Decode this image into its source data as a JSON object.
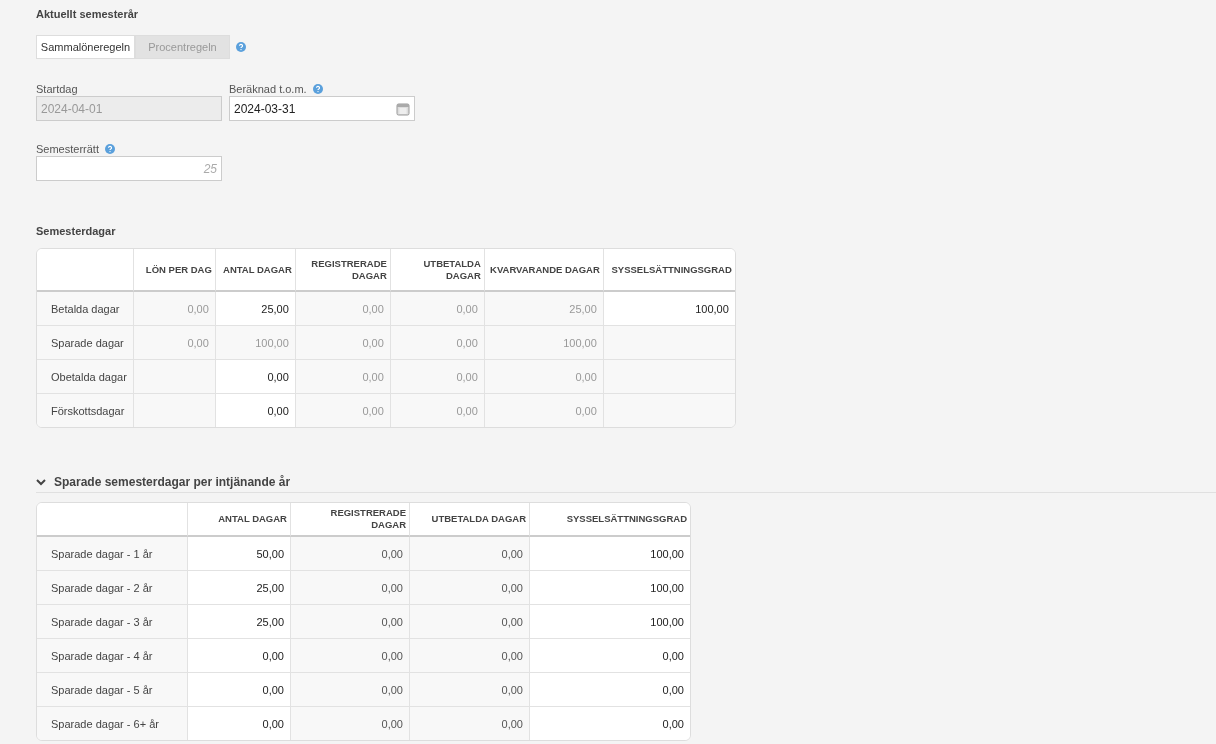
{
  "section_title": "Aktuellt semesterår",
  "rule_toggle": [
    {
      "label": "Sammalöneregeln",
      "selected": true
    },
    {
      "label": "Procentregeln",
      "selected": false
    }
  ],
  "fields": [
    {
      "label": "Startdag",
      "value": "2024-04-01",
      "disabled": true
    },
    {
      "label": "Beräknad t.o.m.",
      "value": "2024-03-31",
      "disabled": false,
      "help": true,
      "calendar": true
    }
  ],
  "semesterratt": {
    "label": "Semesterrätt",
    "placeholder": "25",
    "help": true
  },
  "vacation_days": {
    "title": "Semesterdagar",
    "columns": [
      "",
      "LÖN PER DAG",
      "ANTAL DAGAR",
      "REGISTRERADE DAGAR",
      "UTBETALDA DAGAR",
      "KVARVARANDE DAGAR",
      "SYSSELSÄTTNINGSGRAD"
    ],
    "rows": [
      {
        "cells": [
          {
            "kind": "label",
            "text": "Betalda dagar"
          },
          {
            "text": "0,00",
            "editable": false
          },
          {
            "text": "25,00",
            "editable": true
          },
          {
            "text": "0,00",
            "editable": false
          },
          {
            "text": "0,00",
            "editable": false
          },
          {
            "text": "25,00",
            "editable": false
          },
          {
            "text": "100,00",
            "editable": true
          }
        ]
      },
      {
        "cells": [
          {
            "kind": "label",
            "text": "Sparade dagar"
          },
          {
            "text": "0,00",
            "editable": false
          },
          {
            "text": "100,00",
            "editable": false
          },
          {
            "text": "0,00",
            "editable": false
          },
          {
            "text": "0,00",
            "editable": false
          },
          {
            "text": "100,00",
            "editable": false
          },
          {
            "text": ""
          }
        ]
      },
      {
        "cells": [
          {
            "kind": "label",
            "text": "Obetalda dagar"
          },
          {
            "text": ""
          },
          {
            "text": "0,00",
            "editable": true
          },
          {
            "text": "0,00",
            "editable": false
          },
          {
            "text": "0,00",
            "editable": false
          },
          {
            "text": "0,00",
            "editable": false
          },
          {
            "text": ""
          }
        ]
      },
      {
        "cells": [
          {
            "kind": "label",
            "text": "Förskottsdagar"
          },
          {
            "text": ""
          },
          {
            "text": "0,00",
            "editable": true
          },
          {
            "text": "0,00",
            "editable": false
          },
          {
            "text": "0,00",
            "editable": false
          },
          {
            "text": "0,00",
            "editable": false
          },
          {
            "text": ""
          }
        ]
      }
    ]
  },
  "saved_days": {
    "title": "Sparade semesterdagar per intjänande år",
    "expanded": true,
    "columns": [
      "",
      "ANTAL DAGAR",
      "REGISTRERADE DAGAR",
      "UTBETALDA DAGAR",
      "SYSSELSÄTTNINGSGRAD"
    ],
    "rows": [
      {
        "cells": [
          {
            "kind": "label",
            "text": "Sparade dagar - 1 år"
          },
          {
            "text": "50,00",
            "editable": true
          },
          {
            "text": "0,00",
            "editable": false
          },
          {
            "text": "0,00",
            "editable": false
          },
          {
            "text": "100,00",
            "editable": true
          }
        ]
      },
      {
        "cells": [
          {
            "kind": "label",
            "text": "Sparade dagar - 2 år"
          },
          {
            "text": "25,00",
            "editable": true
          },
          {
            "text": "0,00",
            "editable": false
          },
          {
            "text": "0,00",
            "editable": false
          },
          {
            "text": "100,00",
            "editable": true
          }
        ]
      },
      {
        "cells": [
          {
            "kind": "label",
            "text": "Sparade dagar - 3 år"
          },
          {
            "text": "25,00",
            "editable": true
          },
          {
            "text": "0,00",
            "editable": false
          },
          {
            "text": "0,00",
            "editable": false
          },
          {
            "text": "100,00",
            "editable": true
          }
        ]
      },
      {
        "cells": [
          {
            "kind": "label",
            "text": "Sparade dagar - 4 år"
          },
          {
            "text": "0,00",
            "editable": true
          },
          {
            "text": "0,00",
            "editable": false
          },
          {
            "text": "0,00",
            "editable": false
          },
          {
            "text": "0,00",
            "editable": true
          }
        ]
      },
      {
        "cells": [
          {
            "kind": "label",
            "text": "Sparade dagar - 5 år"
          },
          {
            "text": "0,00",
            "editable": true
          },
          {
            "text": "0,00",
            "editable": false
          },
          {
            "text": "0,00",
            "editable": false
          },
          {
            "text": "0,00",
            "editable": true
          }
        ]
      },
      {
        "cells": [
          {
            "kind": "label",
            "text": "Sparade dagar - 6+ år"
          },
          {
            "text": "0,00",
            "editable": true
          },
          {
            "text": "0,00",
            "editable": false
          },
          {
            "text": "0,00",
            "editable": false
          },
          {
            "text": "0,00",
            "editable": true
          }
        ]
      }
    ]
  }
}
